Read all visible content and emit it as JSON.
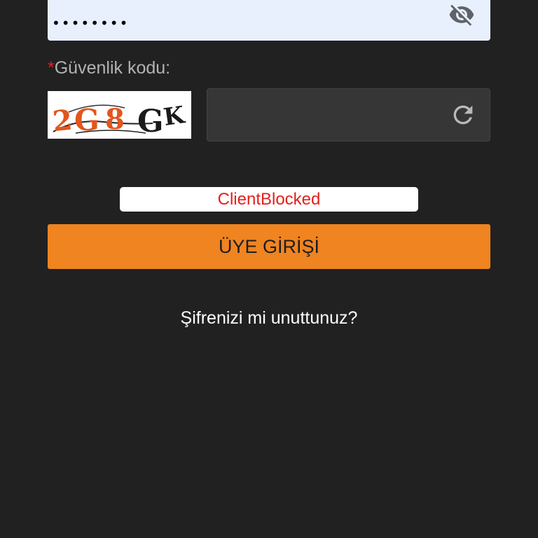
{
  "password": {
    "masked_value": "••••••••",
    "toggle_icon": "eye-off-icon"
  },
  "captcha": {
    "required_mark": "*",
    "label": "Güvenlik kodu:",
    "image_text": "2G8GK",
    "input_value": "",
    "refresh_icon": "refresh-icon"
  },
  "error": {
    "message": "ClientBlocked",
    "color": "#e3201b"
  },
  "login_button": {
    "label": "ÜYE GİRİŞİ",
    "color": "#ef8420"
  },
  "forgot_password": {
    "label": "Şifrenizi mi unuttunuz?"
  }
}
